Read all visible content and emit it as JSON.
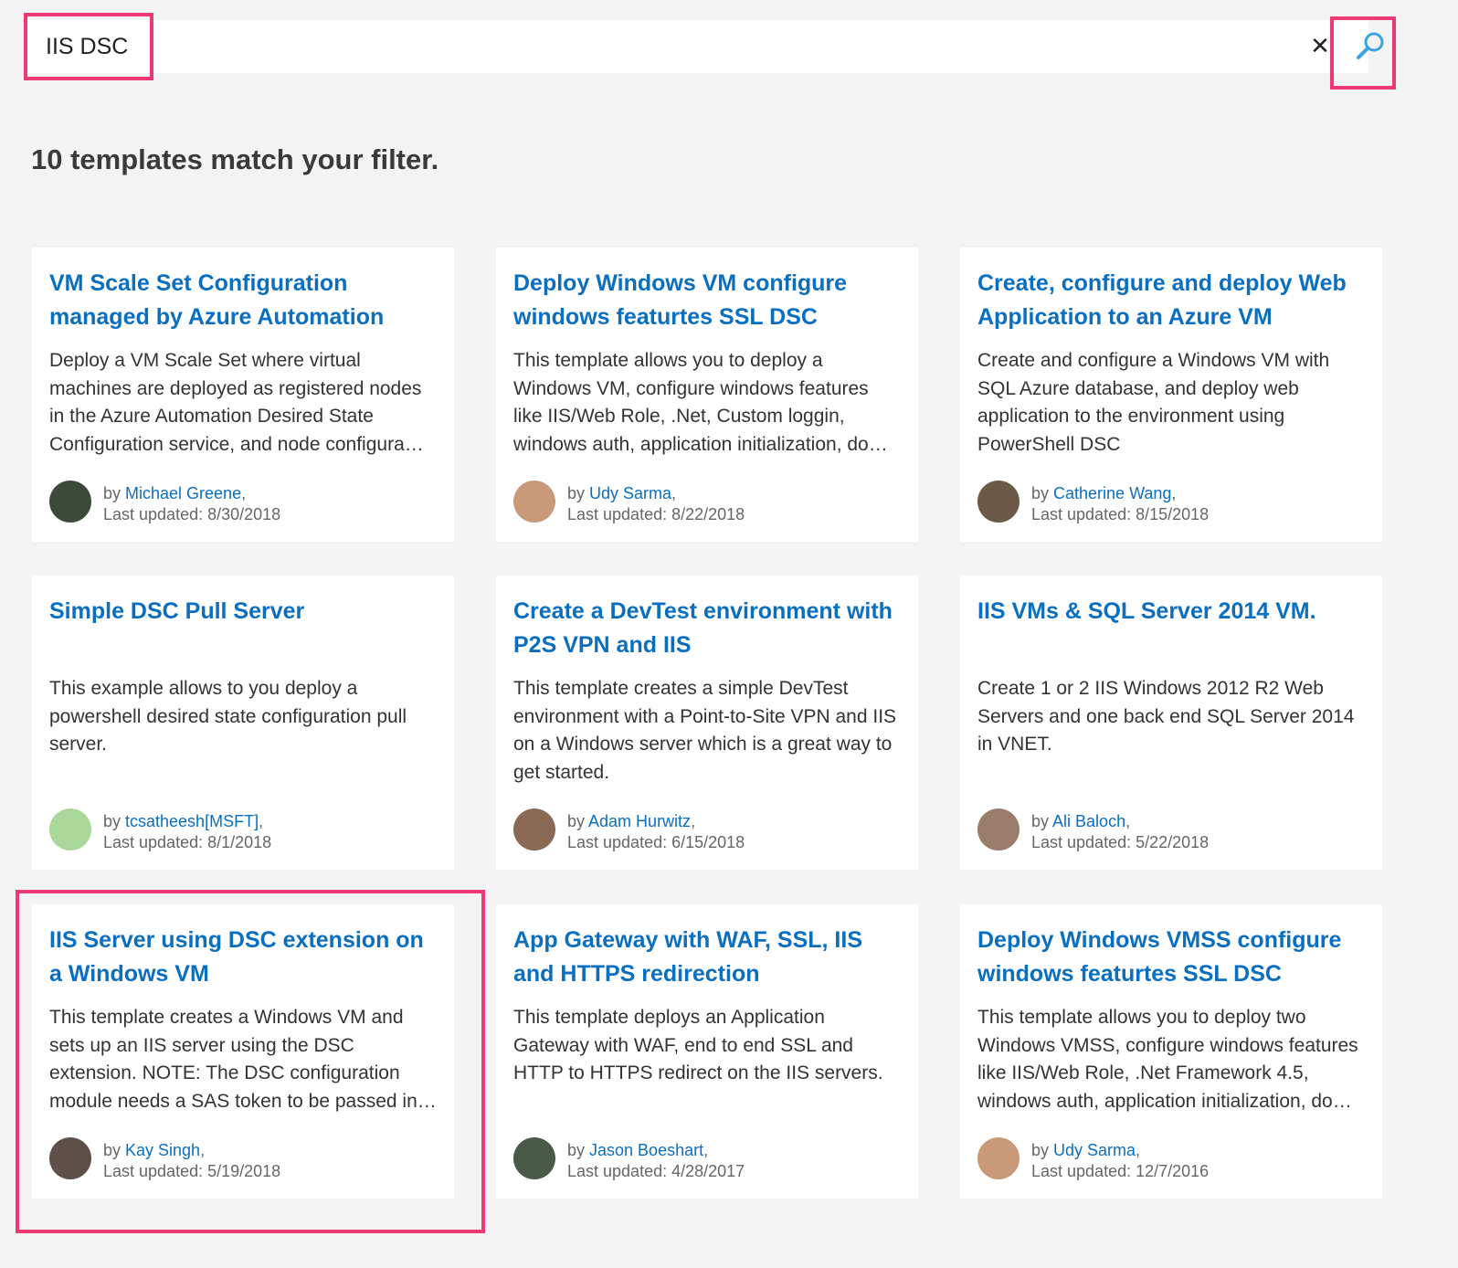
{
  "search": {
    "value": "IIS DSC",
    "clear_label": "✕"
  },
  "result_count": "10 templates match your filter.",
  "labels": {
    "by": "by ",
    "last_updated": "Last updated: "
  },
  "colors": {
    "link": "#0a6ec1",
    "highlight": "#ee3a72",
    "page_bg": "#f4f4f4"
  },
  "cards": [
    {
      "title": "VM Scale Set Configuration managed by Azure Automation",
      "description": "Deploy a VM Scale Set where virtual machines are deployed as registered nodes in the Azure Automation Desired State Configuration service, and node configura…",
      "author": "Michael Greene",
      "date": "8/30/2018",
      "avatar_color": "#3c4a3a"
    },
    {
      "title": "Deploy Windows VM configure windows featurtes SSL DSC",
      "description": "This template allows you to deploy a Windows VM, configure windows features like IIS/Web Role, .Net, Custom loggin, windows auth, application initialization, do…",
      "author": "Udy Sarma",
      "date": "8/22/2018",
      "avatar_color": "#c89a7a"
    },
    {
      "title": "Create, configure and deploy Web Application to an Azure VM",
      "description": "Create and configure a Windows VM with SQL Azure database, and deploy web application to the environment using PowerShell DSC",
      "author": "Catherine Wang",
      "date": "8/15/2018",
      "avatar_color": "#6b5a48"
    },
    {
      "title": "Simple DSC Pull Server",
      "description": "This example allows to you deploy a powershell desired state configuration pull server.",
      "author": "tcsatheesh[MSFT]",
      "date": "8/1/2018",
      "avatar_color": "#a9d89a"
    },
    {
      "title": "Create a DevTest environment with P2S VPN and IIS",
      "description": "This template creates a simple DevTest environment with a Point-to-Site VPN and IIS on a Windows server which is a great way to get started.",
      "author": "Adam Hurwitz",
      "date": "6/15/2018",
      "avatar_color": "#8a6a55"
    },
    {
      "title": "IIS VMs & SQL Server 2014 VM.",
      "description": "Create 1 or 2 IIS Windows 2012 R2 Web Servers and one back end SQL Server 2014 in VNET.",
      "author": "Ali Baloch",
      "date": "5/22/2018",
      "avatar_color": "#9a7c6a"
    },
    {
      "title": "IIS Server using DSC extension on a Windows VM",
      "description": "This template creates a Windows VM and sets up an IIS server using the DSC extension. NOTE: The DSC configuration module needs a SAS token to be passed in…",
      "author": "Kay Singh",
      "date": "5/19/2018",
      "avatar_color": "#5e5048"
    },
    {
      "title": "App Gateway with WAF, SSL, IIS and HTTPS redirection",
      "description": "This template deploys an Application Gateway with WAF, end to end SSL and HTTP to HTTPS redirect on the IIS servers.",
      "author": "Jason Boeshart",
      "date": "4/28/2017",
      "avatar_color": "#4a5a48"
    },
    {
      "title": "Deploy Windows VMSS configure windows featurtes SSL DSC",
      "description": "This template allows you to deploy two Windows VMSS, configure windows features like IIS/Web Role, .Net Framework 4.5, windows auth, application initialization, do…",
      "author": "Udy Sarma",
      "date": "12/7/2016",
      "avatar_color": "#c89a7a"
    }
  ]
}
